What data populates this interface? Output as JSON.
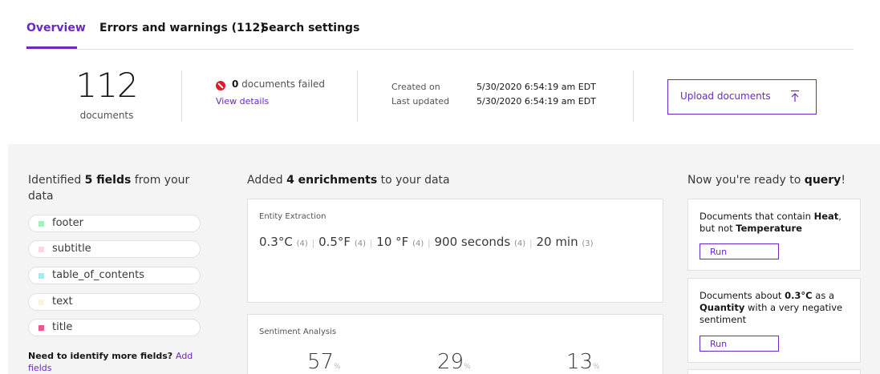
{
  "tabs": [
    {
      "label": "Overview",
      "active": true
    },
    {
      "label": "Errors and warnings (112)",
      "active": false
    },
    {
      "label": "Search settings",
      "active": false
    }
  ],
  "summary": {
    "doc_count": "112",
    "doc_label": "documents",
    "failed_count": "0",
    "failed_label": " documents failed",
    "view_details": "View details",
    "created_label": "Created on",
    "created_value": "5/30/2020 6:54:19 am EDT",
    "updated_label": "Last updated",
    "updated_value": "5/30/2020 6:54:19 am EDT",
    "upload_label": "Upload documents"
  },
  "fields": {
    "heading_pre": "Identified ",
    "heading_bold": "5 fields",
    "heading_post": " from your data",
    "items": [
      {
        "label": "footer",
        "color": "#a7f0ba"
      },
      {
        "label": "subtitle",
        "color": "#ffd6e8"
      },
      {
        "label": "table_of_contents",
        "color": "#9ef0f0"
      },
      {
        "label": "text",
        "color": "#fcf4d6"
      },
      {
        "label": "title",
        "color": "#ee5396"
      }
    ],
    "more_text": "Need to identify more fields? ",
    "more_link": "Add fields"
  },
  "enrichments": {
    "heading_pre": "Added ",
    "heading_bold": "4 enrichments",
    "heading_post": " to your data",
    "entity_card": {
      "title": "Entity Extraction",
      "entities": [
        {
          "value": "0.3°C",
          "count": "(4)"
        },
        {
          "value": "0.5°F",
          "count": "(4)"
        },
        {
          "value": "10 °F",
          "count": "(4)"
        },
        {
          "value": "900 seconds",
          "count": "(4)"
        },
        {
          "value": "20 min",
          "count": "(3)"
        }
      ]
    },
    "sentiment_card": {
      "title": "Sentiment Analysis",
      "values": [
        {
          "value": "57",
          "unit": "%"
        },
        {
          "value": "29",
          "unit": "%"
        },
        {
          "value": "13",
          "unit": "%"
        }
      ]
    }
  },
  "query": {
    "heading_pre": "Now you're ready to ",
    "heading_bold": "query",
    "heading_post": "!",
    "cards": [
      {
        "t1": "Documents that contain ",
        "b1": "Heat",
        "t2": ", but not ",
        "b2": "Temperature",
        "t3": "",
        "b3": "",
        "t4": "",
        "run": "Run"
      },
      {
        "t1": "Documents about ",
        "b1": "0.3°C",
        "t2": " as a ",
        "b2": "Quantity",
        "t3": " with a very negative sentiment",
        "b3": "",
        "t4": "",
        "run": "Run"
      }
    ]
  },
  "colors": {
    "accent": "#6929c4",
    "error": "#da1e28"
  }
}
